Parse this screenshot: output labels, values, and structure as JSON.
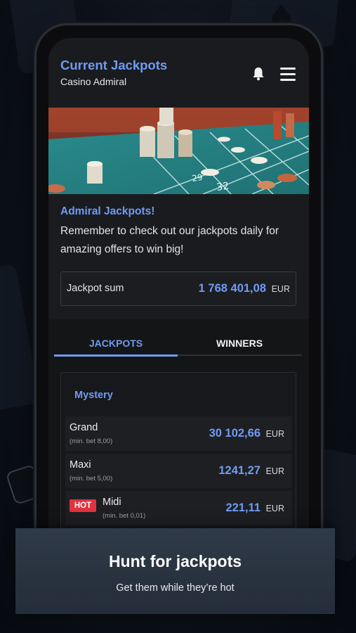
{
  "header": {
    "title": "Current Jackpots",
    "subtitle": "Casino Admiral"
  },
  "promo": {
    "title": "Admiral Jackpots!",
    "text": "Remember to check out our jackpots daily for amazing offers to win big!"
  },
  "jackpot_sum": {
    "label": "Jackpot sum",
    "value": "1 768 401,08",
    "currency": "EUR"
  },
  "tabs": [
    {
      "label": "JACKPOTS",
      "active": true
    },
    {
      "label": "WINNERS",
      "active": false
    }
  ],
  "group": {
    "title": "Mystery",
    "rows": [
      {
        "name": "Grand",
        "min": "(min. bet 8,00)",
        "value": "30 102,66",
        "currency": "EUR"
      },
      {
        "name": "Maxi",
        "min": "(min. bet 5,00)",
        "value": "1241,27",
        "currency": "EUR"
      },
      {
        "name": "Midi",
        "min": "(min. bet 0,01)",
        "value": "221,11",
        "currency": "EUR",
        "badge": "HOT"
      }
    ]
  },
  "banner": {
    "title": "Hunt for jackpots",
    "subtitle": "Get them while they’re hot"
  },
  "icons": {
    "notifications": "bell-icon",
    "menu": "hamburger-menu-icon"
  },
  "colors": {
    "accent": "#6f9bf5",
    "hot_badge": "#e0323f",
    "screen_bg": "#1a1b1e"
  }
}
